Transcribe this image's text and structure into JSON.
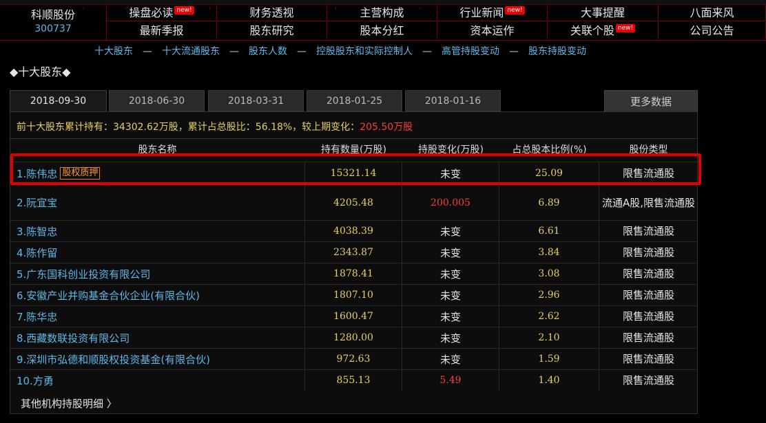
{
  "stock": {
    "name": "科顺股份",
    "code": "300737"
  },
  "nav_row1": [
    {
      "label": "操盘必读",
      "new": true
    },
    {
      "label": "财务透视",
      "new": false
    },
    {
      "label": "主营构成",
      "new": false
    },
    {
      "label": "行业新闻",
      "new": true
    },
    {
      "label": "大事提醒",
      "new": false
    },
    {
      "label": "八面来风",
      "new": false
    }
  ],
  "nav_row2": [
    {
      "label": "最新季报",
      "new": false
    },
    {
      "label": "股东研究",
      "new": false
    },
    {
      "label": "股本分红",
      "new": false
    },
    {
      "label": "资本运作",
      "new": false
    },
    {
      "label": "关联个股",
      "new": true
    },
    {
      "label": "公司公告",
      "new": false
    }
  ],
  "new_badge": "new!",
  "subnav": [
    "十大股东",
    "十大流通股东",
    "股东人数",
    "控股股东和实际控制人",
    "高管持股变动",
    "股东持股变动"
  ],
  "subnav_sep": "—",
  "section_title": "◆十大股东◆",
  "tabs": [
    "2018-09-30",
    "2018-06-30",
    "2018-03-31",
    "2018-01-25",
    "2018-01-16"
  ],
  "more_data": "更多数据",
  "summary": {
    "prefix": "前十大股东累计持有：34302.62万股，累计占总股比：56.18%，较上期变化：",
    "change": "205.50万股"
  },
  "columns": [
    "股东名称",
    "持有数量(万股)",
    "持股变化(万股)",
    "占总股本比例(%)",
    "股份类型"
  ],
  "pledge_label": "股权质押",
  "rows": [
    {
      "name": "1.陈伟忠",
      "qty": "15321.14",
      "chg": "未变",
      "pct": "25.09",
      "type": "限售流通股",
      "pledge": true
    },
    {
      "name": "2.阮宜宝",
      "qty": "4205.48",
      "chg": "200.005",
      "pct": "6.89",
      "type": "流通A股,限售流通股"
    },
    {
      "name": "3.陈智忠",
      "qty": "4038.39",
      "chg": "未变",
      "pct": "6.61",
      "type": "限售流通股"
    },
    {
      "name": "4.陈作留",
      "qty": "2343.87",
      "chg": "未变",
      "pct": "3.84",
      "type": "限售流通股"
    },
    {
      "name": "5.广东国科创业投资有限公司",
      "qty": "1878.41",
      "chg": "未变",
      "pct": "3.08",
      "type": "限售流通股"
    },
    {
      "name": "6.安徽产业并购基金合伙企业(有限合伙)",
      "qty": "1807.10",
      "chg": "未变",
      "pct": "2.96",
      "type": "限售流通股"
    },
    {
      "name": "7.陈华忠",
      "qty": "1600.47",
      "chg": "未变",
      "pct": "2.62",
      "type": "限售流通股"
    },
    {
      "name": "8.西藏数联投资有限公司",
      "qty": "1280.00",
      "chg": "未变",
      "pct": "2.10",
      "type": "限售流通股"
    },
    {
      "name": "9.深圳市弘德和顺股权投资基金(有限合伙)",
      "qty": "972.63",
      "chg": "未变",
      "pct": "1.59",
      "type": "限售流通股"
    },
    {
      "name": "10.方勇",
      "qty": "855.13",
      "chg": "5.49",
      "pct": "1.40",
      "type": "限售流通股"
    }
  ],
  "footer_link": "其他机构持股明细 〉",
  "colors": {
    "accent_blue": "#5fb8e8",
    "value_yellow": "#e8d060",
    "change_red": "#ff3b3b",
    "highlight": "#e00000"
  }
}
